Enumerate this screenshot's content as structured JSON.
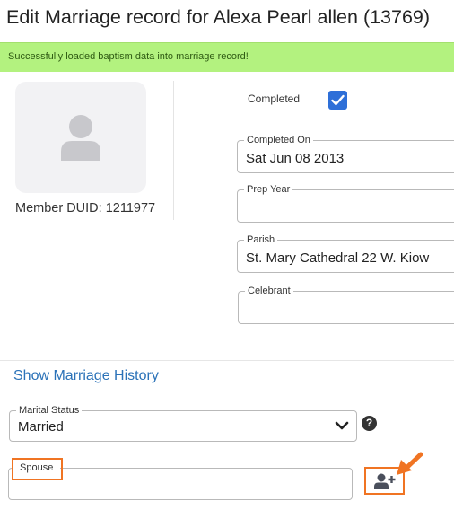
{
  "page": {
    "title": "Edit Marriage record for Alexa Pearl allen (13769)"
  },
  "alert": {
    "message": "Successfully loaded baptism data into marriage record!",
    "color": "#b3f27f"
  },
  "member": {
    "avatar_icon": "user-silhouette-icon",
    "duid_label": "Member DUID: 1211977"
  },
  "form": {
    "completed_label": "Completed",
    "completed_checked": true,
    "completed_on": {
      "label": "Completed On",
      "value": "Sat Jun 08 2013"
    },
    "prep_year": {
      "label": "Prep Year",
      "value": ""
    },
    "parish": {
      "label": "Parish",
      "value": "St. Mary Cathedral 22 W. Kiow"
    },
    "celebrant": {
      "label": "Celebrant",
      "value": ""
    }
  },
  "history": {
    "link_label": "Show Marriage History"
  },
  "marital": {
    "label": "Marital Status",
    "value": "Married",
    "help_symbol": "?"
  },
  "spouse": {
    "label": "Spouse",
    "value": "",
    "add_icon": "add-user-icon"
  },
  "colors": {
    "accent_blue": "#2e6fd8",
    "link_blue": "#2b72b8",
    "highlight_orange": "#f07423"
  }
}
